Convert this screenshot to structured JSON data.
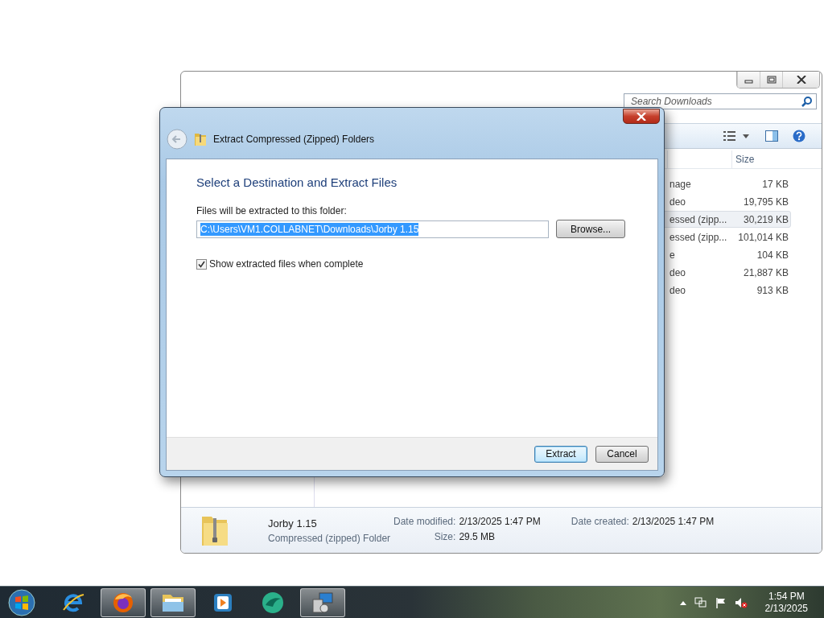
{
  "explorer": {
    "search": {
      "placeholder": "Search Downloads"
    },
    "columns": [
      {
        "label": "Size"
      }
    ],
    "rows": [
      {
        "type": "nage",
        "size": "17 KB",
        "selected": false
      },
      {
        "type": "deo",
        "size": "19,795 KB",
        "selected": false
      },
      {
        "type": "essed (zipp...",
        "size": "30,219 KB",
        "selected": true
      },
      {
        "type": "essed (zipp...",
        "size": "101,014 KB",
        "selected": false
      },
      {
        "type": "e",
        "size": "104 KB",
        "selected": false
      },
      {
        "type": "deo",
        "size": "21,887 KB",
        "selected": false
      },
      {
        "type": "deo",
        "size": "913 KB",
        "selected": false
      }
    ],
    "details": {
      "name": "Jorby 1.15",
      "type": "Compressed (zipped) Folder",
      "fields": [
        {
          "label": "Date modified:",
          "value": "2/13/2025 1:47 PM"
        },
        {
          "label": "Size:",
          "value": "29.5 MB"
        },
        {
          "label": "Date created:",
          "value": "2/13/2025 1:47 PM"
        }
      ]
    }
  },
  "dialog": {
    "title": "Extract Compressed (Zipped) Folders",
    "heading": "Select a Destination and Extract Files",
    "field_label": "Files will be extracted to this folder:",
    "path": "C:\\Users\\VM1.COLLABNET\\Downloads\\Jorby 1.15",
    "path_selected": true,
    "browse": "Browse...",
    "show_files": {
      "label": "Show extracted files when complete",
      "checked": true
    },
    "buttons": [
      {
        "label": "Extract",
        "default": true
      },
      {
        "label": "Cancel",
        "default": false
      }
    ]
  },
  "taskbar": {
    "apps": [
      {
        "kind": "browser",
        "active": false
      },
      {
        "kind": "firefox",
        "active": true
      },
      {
        "kind": "folder",
        "active": true
      },
      {
        "kind": "media",
        "active": false
      },
      {
        "kind": "bird",
        "active": false
      },
      {
        "kind": "installer",
        "active": true
      }
    ],
    "clock": {
      "time": "1:54 PM",
      "date": "2/13/2025"
    }
  }
}
